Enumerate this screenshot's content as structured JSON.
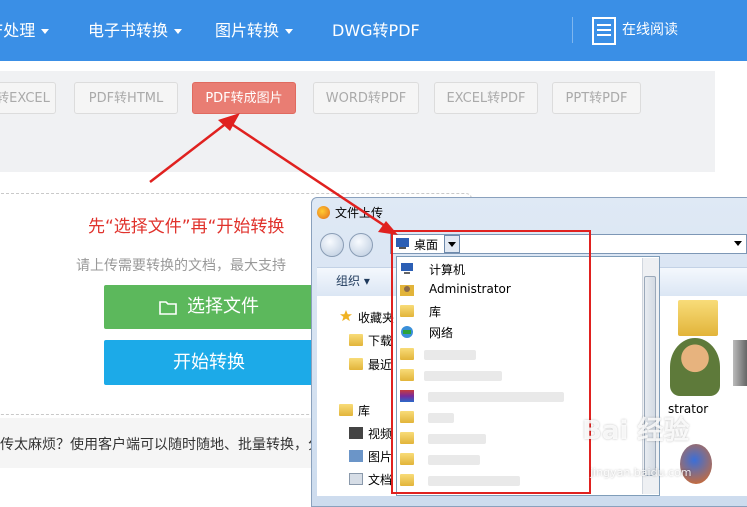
{
  "nav": {
    "items": [
      "F处理",
      "电子书转换",
      "图片转换",
      "DWG转PDF"
    ],
    "online_read": "在线阅读"
  },
  "tabs": [
    "转EXCEL",
    "PDF转HTML",
    "PDF转成图片",
    "WORD转PDF",
    "EXCEL转PDF",
    "PPT转PDF"
  ],
  "upload": {
    "tip_red": "先“选择文件”再“开始转换",
    "tip_gray": "请上传需要转换的文档，最大支持",
    "choose_label": "选择文件",
    "start_label": "开始转换"
  },
  "bottom_text": "传太麻烦？使用客户端可以随时随地、批量转换，分",
  "dialog": {
    "title": "文件上传",
    "address": "桌面",
    "organize": "组织 ▾",
    "left_items": [
      "收藏夹",
      "下载",
      "最近",
      "库",
      "视频",
      "图片",
      "文档"
    ],
    "list_items": [
      "计算机",
      "Administrator",
      "库",
      "网络"
    ],
    "right_label": "strator"
  },
  "watermark": {
    "main": "Bai 经验",
    "sub": "jingyan.baidu.com"
  },
  "colors": {
    "nav_bg": "#3a8fe6",
    "active_tab": "#e97d73",
    "choose": "#5cb85c",
    "start": "#1caae8",
    "highlight": "#e0211f"
  }
}
